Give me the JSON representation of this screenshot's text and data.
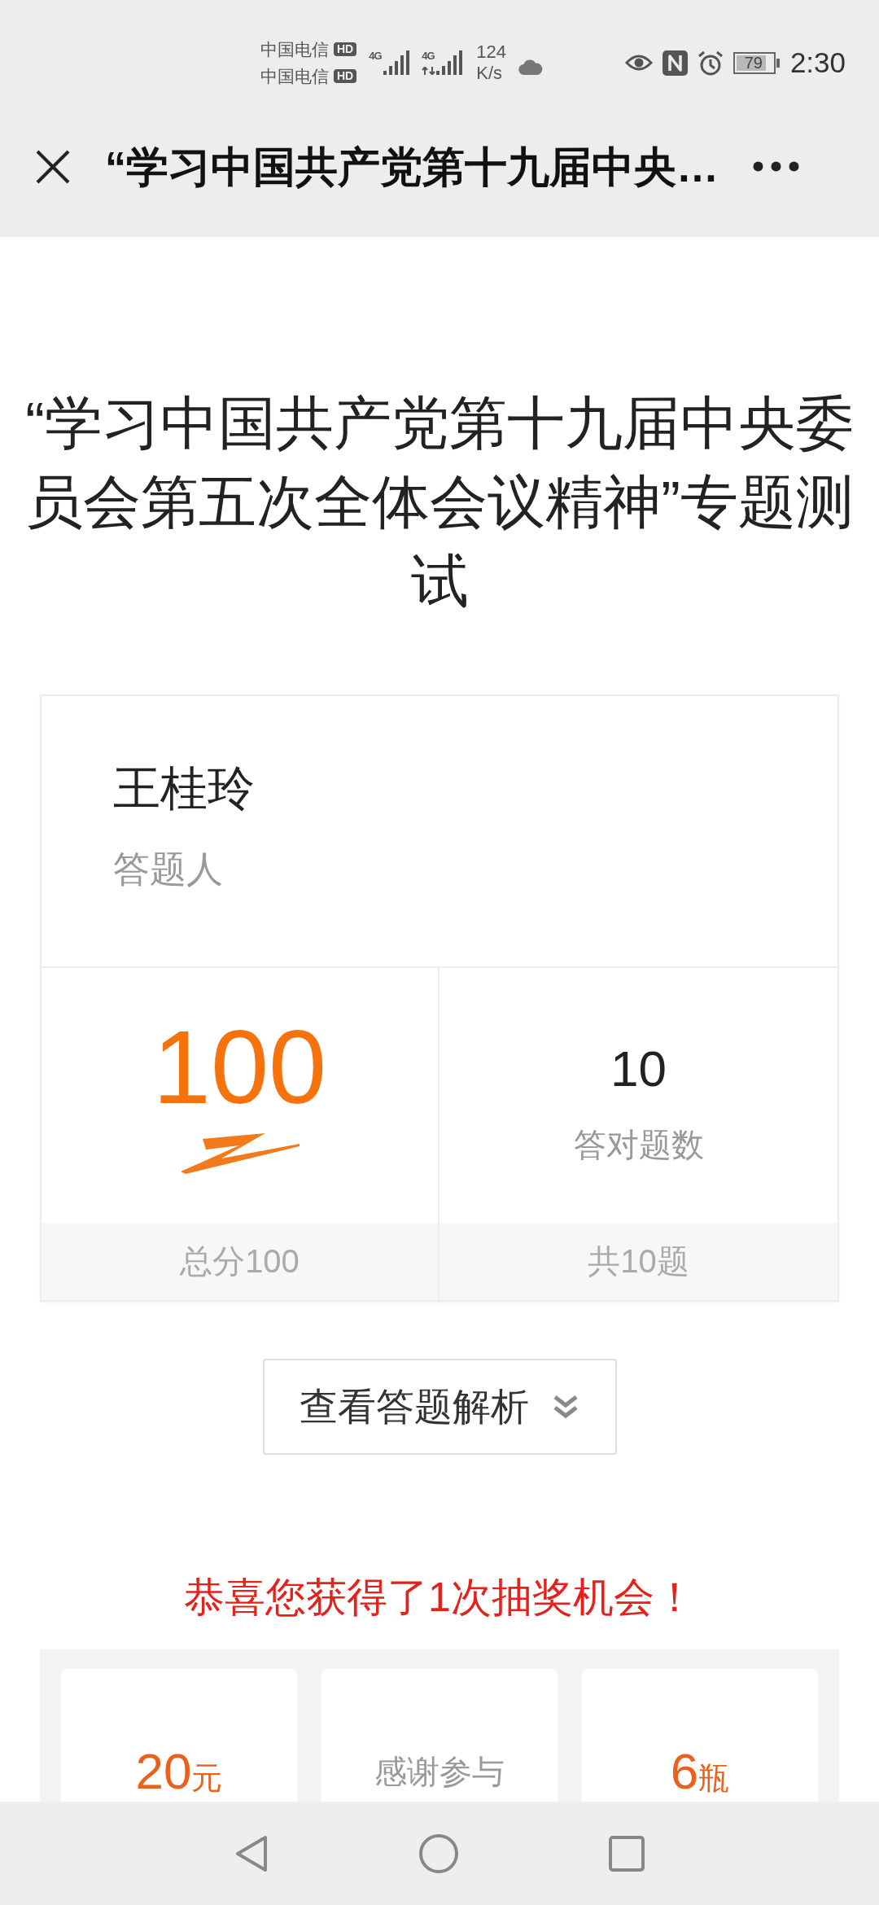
{
  "status_bar": {
    "carriers": [
      {
        "name": "中国电信",
        "badge": "HD"
      },
      {
        "name": "中国电信",
        "badge": "HD"
      }
    ],
    "signals": [
      {
        "label": "4G",
        "kind": "plain"
      },
      {
        "label": "4G",
        "kind": "data"
      }
    ],
    "speed": {
      "value": "124",
      "unit": "K/s"
    },
    "battery": "79",
    "time": "2:30"
  },
  "title_bar": {
    "title": "“学习中国共产党第十九届中央…"
  },
  "quiz": {
    "title": "“学习中国共产党第十九届中央委员会第五次全体会议精神”专题测试"
  },
  "result_card": {
    "name": "王桂玲",
    "name_label": "答题人",
    "stats": [
      {
        "kind": "score",
        "value": "100",
        "footer": "总分100"
      },
      {
        "kind": "count",
        "value": "10",
        "label": "答对题数",
        "footer": "共10题"
      }
    ]
  },
  "analysis_button": {
    "label": "查看答题解析"
  },
  "lottery": {
    "message": "恭喜您获得了1次抽奖机会！",
    "prizes": [
      {
        "kind": "amount",
        "value": "20",
        "unit": "元"
      },
      {
        "kind": "text",
        "label": "感谢参与"
      },
      {
        "kind": "amount",
        "value": "6",
        "unit": "瓶"
      }
    ]
  }
}
